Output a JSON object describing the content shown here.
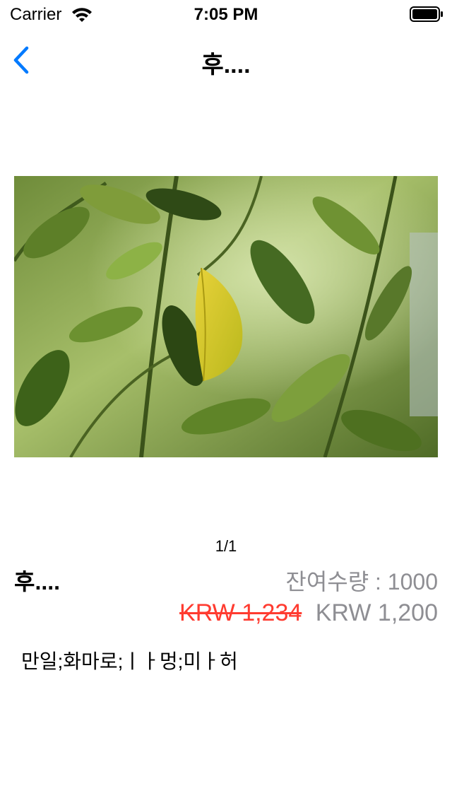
{
  "status_bar": {
    "carrier": "Carrier",
    "time": "7:05 PM",
    "icons": [
      "wifi-icon",
      "battery-icon"
    ]
  },
  "nav": {
    "title": "후....",
    "back_icon": "chevron-left-icon"
  },
  "colors": {
    "accent": "#007aff",
    "strike_price": "#ff3b30",
    "secondary_text": "#8e8e93"
  },
  "product": {
    "image_description": "photo of green citrus leaves with one yellow leaf",
    "page_indicator": "1/1",
    "name": "후....",
    "stock": "잔여수량 : 1000",
    "original_price": "KRW 1,234",
    "sale_price": "KRW 1,200",
    "description": "만일;화마로;ㅣㅏ멍;미ㅏ허"
  }
}
